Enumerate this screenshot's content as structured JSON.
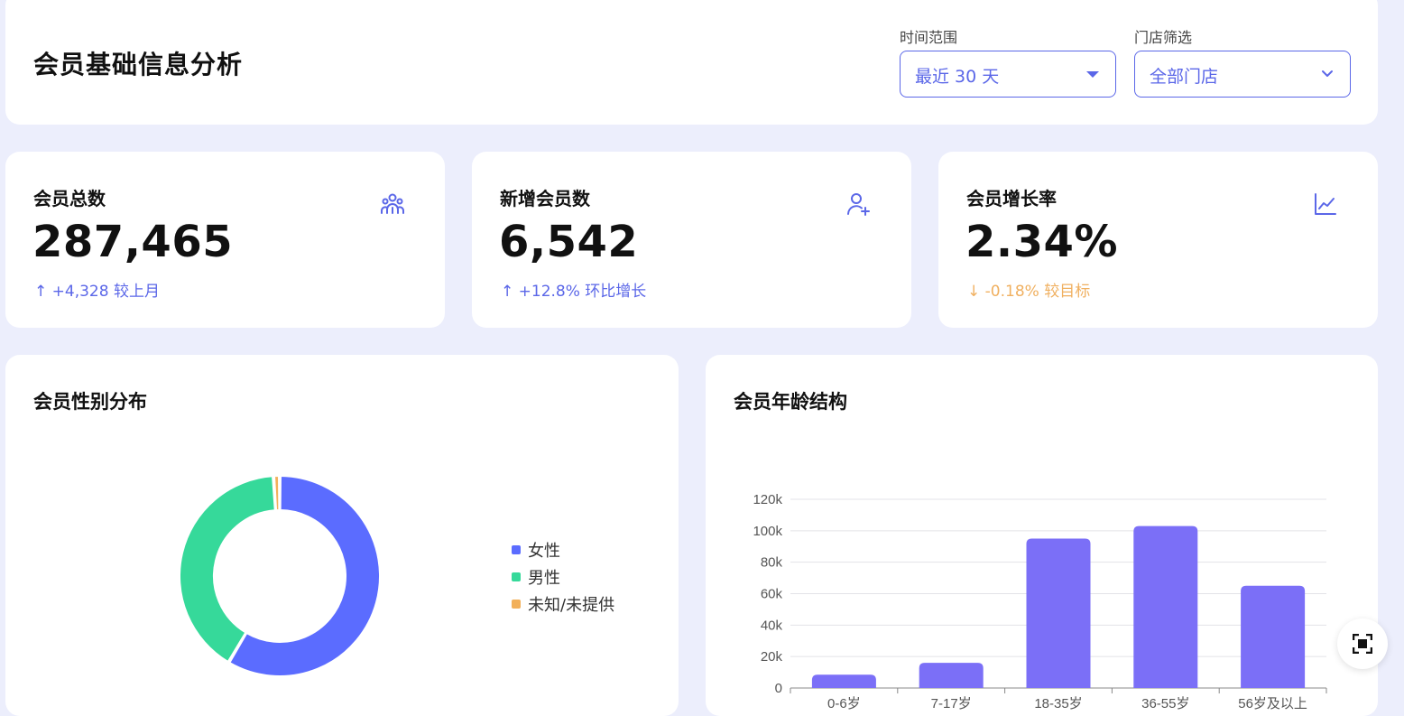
{
  "header": {
    "title": "会员基础信息分析",
    "time_label": "时间范围",
    "time_value": "最近 30 天",
    "store_label": "门店筛选",
    "store_value": "全部门店"
  },
  "kpis": [
    {
      "title": "会员总数",
      "value": "287,465",
      "delta": "↑  +4,328 较上月",
      "icon": "users-group-icon",
      "trend": "up"
    },
    {
      "title": "新增会员数",
      "value": "6,542",
      "delta": "↑  +12.8% 环比增长",
      "icon": "user-add-icon",
      "trend": "up"
    },
    {
      "title": "会员增长率",
      "value": "2.34%",
      "delta": "↓  -0.18% 较目标",
      "icon": "line-chart-icon",
      "trend": "down"
    }
  ],
  "gender": {
    "title": "会员性别分布",
    "legend": [
      {
        "label": "女性",
        "color": "#5b6cff"
      },
      {
        "label": "男性",
        "color": "#36d99a"
      },
      {
        "label": "未知/未提供",
        "color": "#f2b05a"
      }
    ]
  },
  "age": {
    "title": "会员年龄结构"
  },
  "colors": {
    "accent": "#5b67e8",
    "bar": "#7b6ff7",
    "up": "#5b67e8",
    "down": "#f0b060"
  },
  "chart_data": [
    {
      "type": "pie",
      "categories": [
        "女性",
        "男性",
        "未知/未提供"
      ],
      "values": [
        58.5,
        40.5,
        1.0
      ],
      "colors": [
        "#5b6cff",
        "#36d99a",
        "#f2b05a"
      ],
      "donut": true,
      "legend": "right"
    },
    {
      "type": "bar",
      "categories": [
        "0-6岁",
        "7-17岁",
        "18-35岁",
        "36-55岁",
        "56岁及以上"
      ],
      "values": [
        8500,
        16000,
        95000,
        103000,
        65000
      ],
      "ylim": [
        0,
        120000
      ],
      "yticks": [
        "0",
        "20k",
        "40k",
        "60k",
        "80k",
        "100k",
        "120k"
      ],
      "yticks_values": [
        0,
        20000,
        40000,
        60000,
        80000,
        100000,
        120000
      ],
      "grid": true,
      "color": "#7b6ff7"
    }
  ]
}
